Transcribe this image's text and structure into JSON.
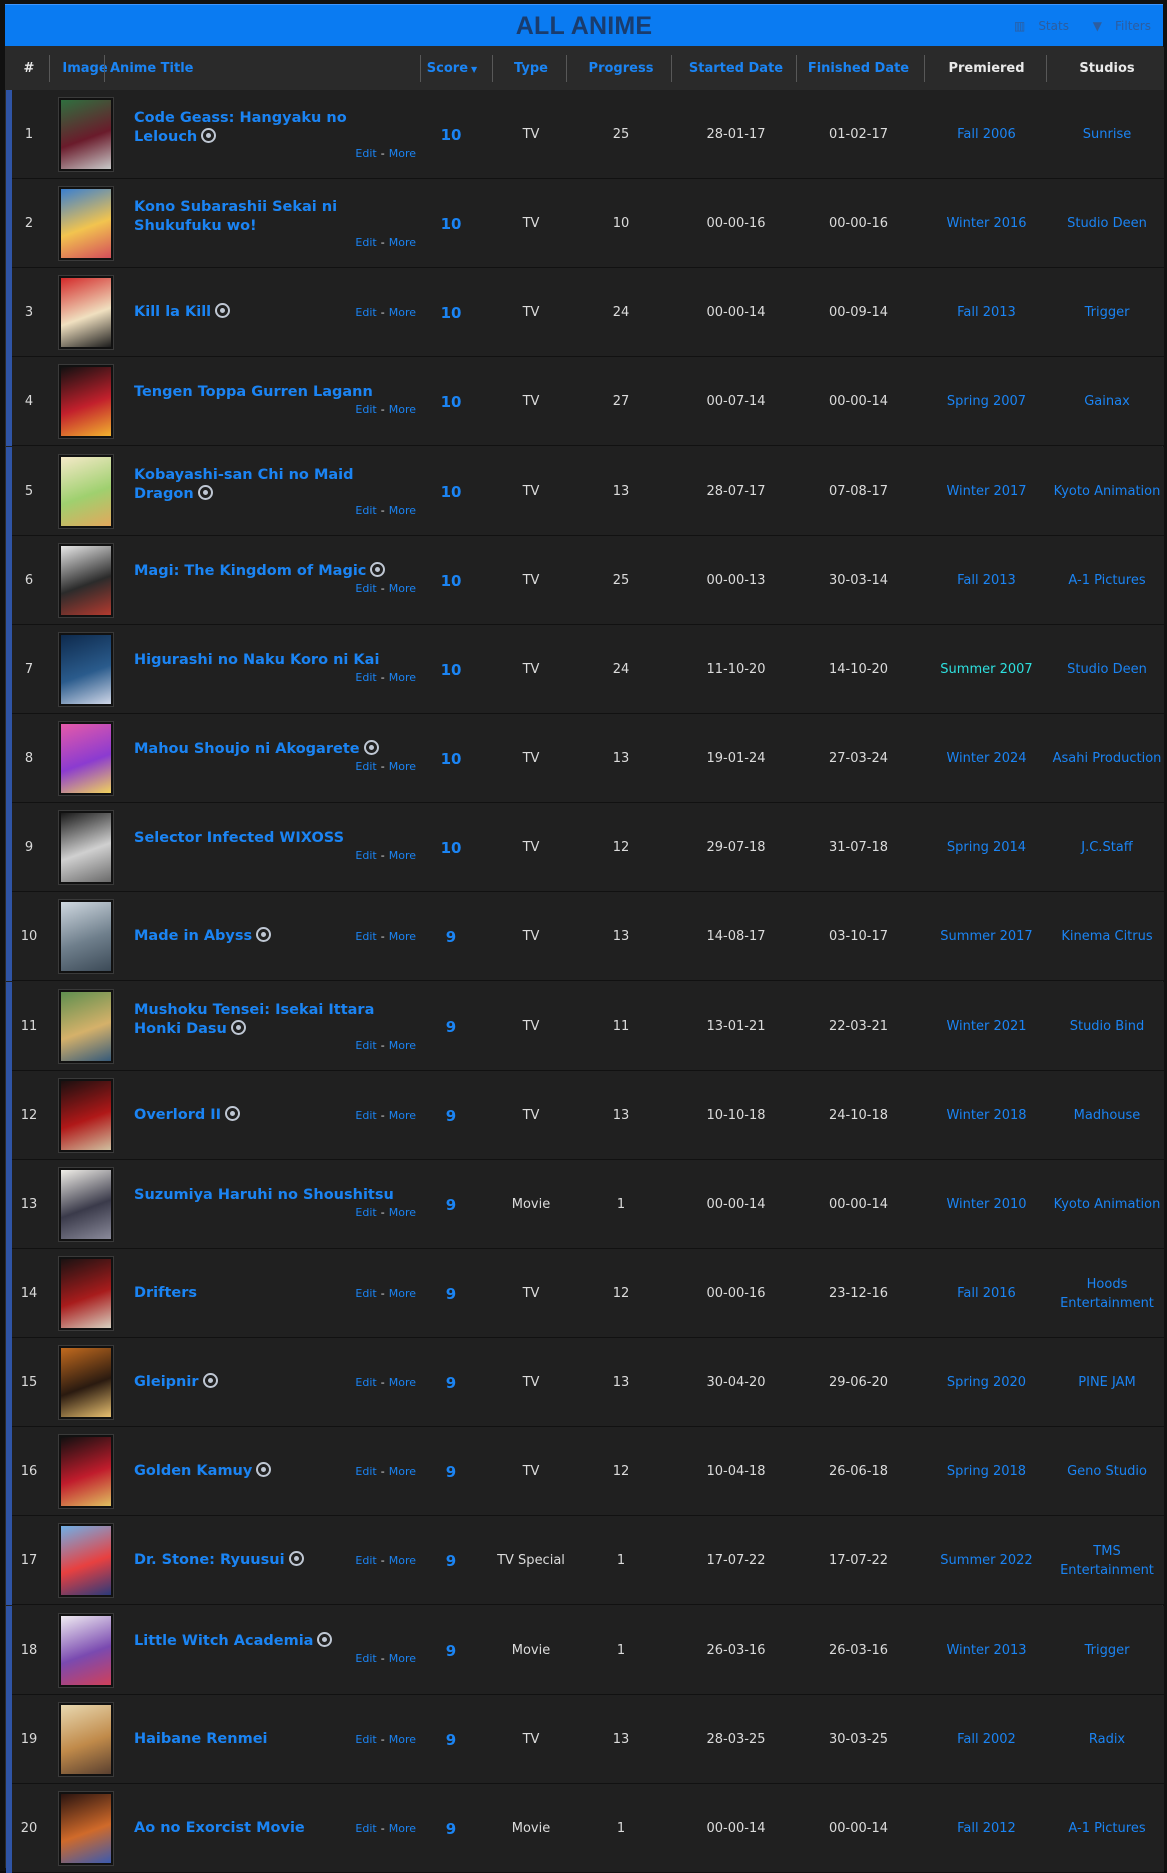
{
  "header": {
    "title": "ALL ANIME",
    "stats_label": "Stats",
    "filters_label": "Filters"
  },
  "columns": {
    "index": "#",
    "image": "Image",
    "title": "Anime Title",
    "score": "Score",
    "type": "Type",
    "progress": "Progress",
    "started": "Started Date",
    "finished": "Finished Date",
    "premiered": "Premiered",
    "studios": "Studios"
  },
  "labels": {
    "edit": "Edit",
    "more": "More"
  },
  "colors": {
    "accent": "#1b84f3",
    "header_bar": "#0a7bf2",
    "row_bg": "#202020",
    "highlight_cyan": "#2ee0df"
  },
  "rows": [
    {
      "index": "1",
      "title": "Code Geass: Hangyaku no Lelouch",
      "airing": true,
      "score": "10",
      "type": "TV",
      "progress": "25",
      "started": "28-01-17",
      "finished": "01-02-17",
      "premiered": "Fall 2006",
      "studio": "Sunrise",
      "img": [
        "#2f6f3f",
        "#6a1b2b",
        "#c9c9c9"
      ]
    },
    {
      "index": "2",
      "title": "Kono Subarashii Sekai ni Shukufuku wo!",
      "airing": false,
      "score": "10",
      "type": "TV",
      "progress": "10",
      "started": "00-00-16",
      "finished": "00-00-16",
      "premiered": "Winter 2016",
      "studio": "Studio Deen",
      "img": [
        "#3a7fd0",
        "#f2c44f",
        "#d44e5a"
      ]
    },
    {
      "index": "3",
      "title": "Kill la Kill",
      "airing": true,
      "score": "10",
      "type": "TV",
      "progress": "24",
      "started": "00-00-14",
      "finished": "00-09-14",
      "premiered": "Fall 2013",
      "studio": "Trigger",
      "img": [
        "#d32a2a",
        "#f0e0c0",
        "#1c1c1c"
      ]
    },
    {
      "index": "4",
      "title": "Tengen Toppa Gurren Lagann",
      "airing": false,
      "score": "10",
      "type": "TV",
      "progress": "27",
      "started": "00-07-14",
      "finished": "00-00-14",
      "premiered": "Spring 2007",
      "studio": "Gainax",
      "img": [
        "#111",
        "#c2202c",
        "#f2b22f"
      ]
    },
    {
      "index": "5",
      "title": "Kobayashi-san Chi no Maid Dragon",
      "airing": true,
      "score": "10",
      "type": "TV",
      "progress": "13",
      "started": "28-07-17",
      "finished": "07-08-17",
      "premiered": "Winter 2017",
      "studio": "Kyoto Animation",
      "img": [
        "#f5e9c8",
        "#9fd06f",
        "#e3a85c"
      ]
    },
    {
      "index": "6",
      "title": "Magi: The Kingdom of Magic",
      "airing": true,
      "score": "10",
      "type": "TV",
      "progress": "25",
      "started": "00-00-13",
      "finished": "30-03-14",
      "premiered": "Fall 2013",
      "studio": "A-1 Pictures",
      "img": [
        "#e8e8e8",
        "#2b2b2b",
        "#b43a2f"
      ]
    },
    {
      "index": "7",
      "title": "Higurashi no Naku Koro ni Kai",
      "airing": false,
      "score": "10",
      "type": "TV",
      "progress": "24",
      "started": "11-10-20",
      "finished": "14-10-20",
      "premiered": "Summer 2007",
      "studio": "Studio Deen",
      "img": [
        "#0e2a4d",
        "#2a5b8c",
        "#d0d7e8"
      ],
      "cyan": true
    },
    {
      "index": "8",
      "title": "Mahou Shoujo ni Akogarete",
      "airing": true,
      "score": "10",
      "type": "TV",
      "progress": "13",
      "started": "19-01-24",
      "finished": "27-03-24",
      "premiered": "Winter 2024",
      "studio": "Asahi Production",
      "img": [
        "#e55aa9",
        "#8b3bd0",
        "#f2d35c"
      ]
    },
    {
      "index": "9",
      "title": "Selector Infected WIXOSS",
      "airing": false,
      "score": "10",
      "type": "TV",
      "progress": "12",
      "started": "29-07-18",
      "finished": "31-07-18",
      "premiered": "Spring 2014",
      "studio": "J.C.Staff",
      "img": [
        "#1a1a1a",
        "#d0d0d0",
        "#6a6a6a"
      ]
    },
    {
      "index": "10",
      "title": "Made in Abyss",
      "airing": true,
      "score": "9",
      "type": "TV",
      "progress": "13",
      "started": "14-08-17",
      "finished": "03-10-17",
      "premiered": "Summer 2017",
      "studio": "Kinema Citrus",
      "img": [
        "#cfd8e0",
        "#6f7f8c",
        "#3c4a57"
      ]
    },
    {
      "index": "11",
      "title": "Mushoku Tensei: Isekai Ittara Honki Dasu",
      "airing": true,
      "score": "9",
      "type": "TV",
      "progress": "11",
      "started": "13-01-21",
      "finished": "22-03-21",
      "premiered": "Winter 2021",
      "studio": "Studio Bind",
      "img": [
        "#5f8f4f",
        "#d5b16a",
        "#355a7a"
      ]
    },
    {
      "index": "12",
      "title": "Overlord II",
      "airing": true,
      "score": "9",
      "type": "TV",
      "progress": "13",
      "started": "10-10-18",
      "finished": "24-10-18",
      "premiered": "Winter 2018",
      "studio": "Madhouse",
      "img": [
        "#1a1010",
        "#b01818",
        "#d0c0a0"
      ]
    },
    {
      "index": "13",
      "title": "Suzumiya Haruhi no Shoushitsu",
      "airing": false,
      "score": "9",
      "type": "Movie",
      "progress": "1",
      "started": "00-00-14",
      "finished": "00-00-14",
      "premiered": "Winter 2010",
      "studio": "Kyoto Animation",
      "img": [
        "#f0eee8",
        "#3a3a4a",
        "#8a8a9a"
      ]
    },
    {
      "index": "14",
      "title": "Drifters",
      "airing": false,
      "score": "9",
      "type": "TV",
      "progress": "12",
      "started": "00-00-16",
      "finished": "23-12-16",
      "premiered": "Fall 2016",
      "studio": "Hoods Entertainment",
      "img": [
        "#1a1212",
        "#a81c1c",
        "#d8d0c0"
      ]
    },
    {
      "index": "15",
      "title": "Gleipnir",
      "airing": true,
      "score": "9",
      "type": "TV",
      "progress": "13",
      "started": "30-04-20",
      "finished": "29-06-20",
      "premiered": "Spring 2020",
      "studio": "PINE JAM",
      "img": [
        "#c26a1e",
        "#2a1a10",
        "#e8c070"
      ]
    },
    {
      "index": "16",
      "title": "Golden Kamuy",
      "airing": true,
      "score": "9",
      "type": "TV",
      "progress": "12",
      "started": "10-04-18",
      "finished": "26-06-18",
      "premiered": "Spring 2018",
      "studio": "Geno Studio",
      "img": [
        "#101010",
        "#c01c2c",
        "#e0c060"
      ]
    },
    {
      "index": "17",
      "title": "Dr. Stone: Ryuusui",
      "airing": true,
      "score": "9",
      "type": "TV Special",
      "progress": "1",
      "started": "17-07-22",
      "finished": "17-07-22",
      "premiered": "Summer 2022",
      "studio": "TMS Entertainment",
      "img": [
        "#6fb0e8",
        "#e84040",
        "#2a3a7a"
      ]
    },
    {
      "index": "18",
      "title": "Little Witch Academia",
      "airing": true,
      "score": "9",
      "type": "Movie",
      "progress": "1",
      "started": "26-03-16",
      "finished": "26-03-16",
      "premiered": "Winter 2013",
      "studio": "Trigger",
      "img": [
        "#f0ecf2",
        "#7a4ab0",
        "#d0405a"
      ]
    },
    {
      "index": "19",
      "title": "Haibane Renmei",
      "airing": false,
      "score": "9",
      "type": "TV",
      "progress": "13",
      "started": "28-03-25",
      "finished": "30-03-25",
      "premiered": "Fall 2002",
      "studio": "Radix",
      "img": [
        "#e8d8b0",
        "#c08a4a",
        "#5a4030"
      ]
    },
    {
      "index": "20",
      "title": "Ao no Exorcist Movie",
      "airing": false,
      "score": "9",
      "type": "Movie",
      "progress": "1",
      "started": "00-00-14",
      "finished": "00-00-14",
      "premiered": "Fall 2012",
      "studio": "A-1 Pictures",
      "img": [
        "#2a1410",
        "#d06a2a",
        "#3a5ab0"
      ]
    }
  ]
}
